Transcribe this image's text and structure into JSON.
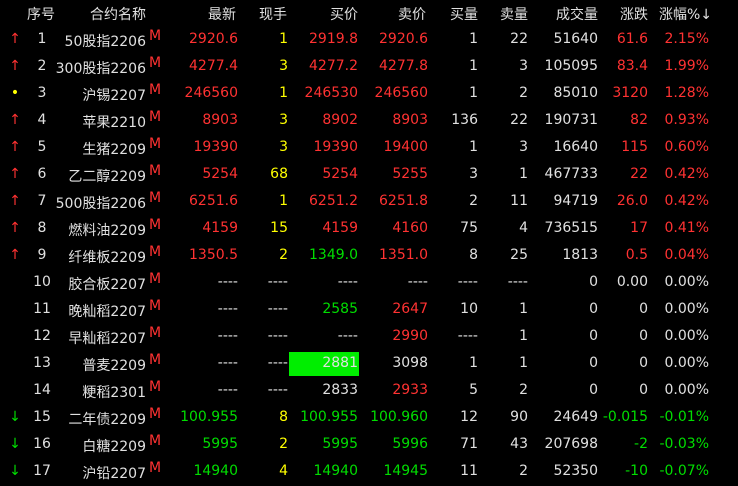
{
  "headers": [
    "序号",
    "合约名称",
    "最新",
    "现手",
    "买价",
    "卖价",
    "买量",
    "卖量",
    "成交量",
    "涨跌",
    "涨幅%↓"
  ],
  "colors": {
    "up": "#ff3232",
    "down": "#00dd00",
    "flat": "#e0e0e0",
    "hand": "#ffff00"
  },
  "rows": [
    {
      "mark": "↑",
      "mc": "red",
      "no": "1",
      "name": "50股指2206",
      "sup": "M",
      "last": "2920.6",
      "lc": "red",
      "hand": "1",
      "hc": "yellow",
      "bid": "2919.8",
      "bc": "red",
      "ask": "2920.6",
      "ac": "red",
      "bq": "1",
      "aq": "22",
      "vol": "51640",
      "chg": "61.6",
      "cc": "red",
      "pct": "2.15%",
      "pc": "red"
    },
    {
      "mark": "↑",
      "mc": "red",
      "no": "2",
      "name": "300股指2206",
      "sup": "M",
      "last": "4277.4",
      "lc": "red",
      "hand": "3",
      "hc": "yellow",
      "bid": "4277.2",
      "bc": "red",
      "ask": "4277.8",
      "ac": "red",
      "bq": "1",
      "aq": "3",
      "vol": "105095",
      "chg": "83.4",
      "cc": "red",
      "pct": "1.99%",
      "pc": "red"
    },
    {
      "mark": "•",
      "mc": "yellow",
      "no": "3",
      "name": "沪锡2207",
      "sup": "M",
      "last": "246560",
      "lc": "red",
      "hand": "1",
      "hc": "yellow",
      "bid": "246530",
      "bc": "red",
      "ask": "246560",
      "ac": "red",
      "bq": "1",
      "aq": "2",
      "vol": "85010",
      "chg": "3120",
      "cc": "red",
      "pct": "1.28%",
      "pc": "red"
    },
    {
      "mark": "↑",
      "mc": "red",
      "no": "4",
      "name": "苹果2210",
      "sup": "M",
      "last": "8903",
      "lc": "red",
      "hand": "3",
      "hc": "yellow",
      "bid": "8902",
      "bc": "red",
      "ask": "8903",
      "ac": "red",
      "bq": "136",
      "aq": "22",
      "vol": "190731",
      "chg": "82",
      "cc": "red",
      "pct": "0.93%",
      "pc": "red"
    },
    {
      "mark": "↑",
      "mc": "red",
      "no": "5",
      "name": "生猪2209",
      "sup": "M",
      "last": "19390",
      "lc": "red",
      "hand": "3",
      "hc": "yellow",
      "bid": "19390",
      "bc": "red",
      "ask": "19400",
      "ac": "red",
      "bq": "1",
      "aq": "3",
      "vol": "16640",
      "chg": "115",
      "cc": "red",
      "pct": "0.60%",
      "pc": "red"
    },
    {
      "mark": "↑",
      "mc": "red",
      "no": "6",
      "name": "乙二醇2209",
      "sup": "M",
      "last": "5254",
      "lc": "red",
      "hand": "68",
      "hc": "yellow",
      "bid": "5254",
      "bc": "red",
      "ask": "5255",
      "ac": "red",
      "bq": "3",
      "aq": "1",
      "vol": "467733",
      "chg": "22",
      "cc": "red",
      "pct": "0.42%",
      "pc": "red"
    },
    {
      "mark": "↑",
      "mc": "red",
      "no": "7",
      "name": "500股指2206",
      "sup": "M",
      "last": "6251.6",
      "lc": "red",
      "hand": "1",
      "hc": "yellow",
      "bid": "6251.2",
      "bc": "red",
      "ask": "6251.8",
      "ac": "red",
      "bq": "2",
      "aq": "11",
      "vol": "94719",
      "chg": "26.0",
      "cc": "red",
      "pct": "0.42%",
      "pc": "red"
    },
    {
      "mark": "↑",
      "mc": "red",
      "no": "8",
      "name": "燃料油2209",
      "sup": "M",
      "last": "4159",
      "lc": "red",
      "hand": "15",
      "hc": "yellow",
      "bid": "4159",
      "bc": "red",
      "ask": "4160",
      "ac": "red",
      "bq": "75",
      "aq": "4",
      "vol": "736515",
      "chg": "17",
      "cc": "red",
      "pct": "0.41%",
      "pc": "red"
    },
    {
      "mark": "↑",
      "mc": "red",
      "no": "9",
      "name": "纤维板2209",
      "sup": "M",
      "last": "1350.5",
      "lc": "red",
      "hand": "2",
      "hc": "yellow",
      "bid": "1349.0",
      "bc": "green",
      "ask": "1351.0",
      "ac": "red",
      "bq": "8",
      "aq": "25",
      "vol": "1813",
      "chg": "0.5",
      "cc": "red",
      "pct": "0.04%",
      "pc": "red"
    },
    {
      "mark": "",
      "mc": "white",
      "no": "10",
      "name": "胶合板2207",
      "sup": "M",
      "last": "----",
      "lc": "white",
      "hand": "----",
      "hc": "white",
      "bid": "----",
      "bc": "white",
      "ask": "----",
      "ac": "white",
      "bq": "----",
      "aq": "----",
      "vol": "0",
      "chg": "0.00",
      "cc": "white",
      "pct": "0.00%",
      "pc": "white"
    },
    {
      "mark": "",
      "mc": "white",
      "no": "11",
      "name": "晚籼稻2207",
      "sup": "M",
      "last": "----",
      "lc": "white",
      "hand": "----",
      "hc": "white",
      "bid": "2585",
      "bc": "green",
      "ask": "2647",
      "ac": "red",
      "bq": "10",
      "aq": "1",
      "vol": "0",
      "chg": "0",
      "cc": "white",
      "pct": "0.00%",
      "pc": "white"
    },
    {
      "mark": "",
      "mc": "white",
      "no": "12",
      "name": "早籼稻2207",
      "sup": "M",
      "last": "----",
      "lc": "white",
      "hand": "----",
      "hc": "white",
      "bid": "----",
      "bc": "white",
      "ask": "2990",
      "ac": "red",
      "bq": "----",
      "aq": "1",
      "vol": "0",
      "chg": "0",
      "cc": "white",
      "pct": "0.00%",
      "pc": "white"
    },
    {
      "mark": "",
      "mc": "white",
      "no": "13",
      "name": "普麦2209",
      "sup": "M",
      "last": "----",
      "lc": "white",
      "hand": "----",
      "hc": "white",
      "bid": "2881",
      "bc": "white",
      "ask": "3098",
      "ac": "white",
      "bq": "1",
      "aq": "1",
      "vol": "0",
      "chg": "0",
      "cc": "white",
      "pct": "0.00%",
      "pc": "white",
      "hl": true
    },
    {
      "mark": "",
      "mc": "white",
      "no": "14",
      "name": "粳稻2301",
      "sup": "M",
      "last": "----",
      "lc": "white",
      "hand": "----",
      "hc": "white",
      "bid": "2833",
      "bc": "white",
      "ask": "2933",
      "ac": "red",
      "bq": "5",
      "aq": "2",
      "vol": "0",
      "chg": "0",
      "cc": "white",
      "pct": "0.00%",
      "pc": "white"
    },
    {
      "mark": "↓",
      "mc": "green",
      "no": "15",
      "name": "二年债2209",
      "sup": "M",
      "last": "100.955",
      "lc": "green",
      "hand": "8",
      "hc": "yellow",
      "bid": "100.955",
      "bc": "green",
      "ask": "100.960",
      "ac": "green",
      "bq": "12",
      "aq": "90",
      "vol": "24649",
      "chg": "-0.015",
      "cc": "green",
      "pct": "-0.01%",
      "pc": "green"
    },
    {
      "mark": "↓",
      "mc": "green",
      "no": "16",
      "name": "白糖2209",
      "sup": "M",
      "last": "5995",
      "lc": "green",
      "hand": "2",
      "hc": "yellow",
      "bid": "5995",
      "bc": "green",
      "ask": "5996",
      "ac": "green",
      "bq": "71",
      "aq": "43",
      "vol": "207698",
      "chg": "-2",
      "cc": "green",
      "pct": "-0.03%",
      "pc": "green"
    },
    {
      "mark": "↓",
      "mc": "green",
      "no": "17",
      "name": "沪铅2207",
      "sup": "M",
      "last": "14940",
      "lc": "green",
      "hand": "4",
      "hc": "yellow",
      "bid": "14940",
      "bc": "green",
      "ask": "14945",
      "ac": "green",
      "bq": "11",
      "aq": "2",
      "vol": "52350",
      "chg": "-10",
      "cc": "green",
      "pct": "-0.07%",
      "pc": "green"
    }
  ]
}
